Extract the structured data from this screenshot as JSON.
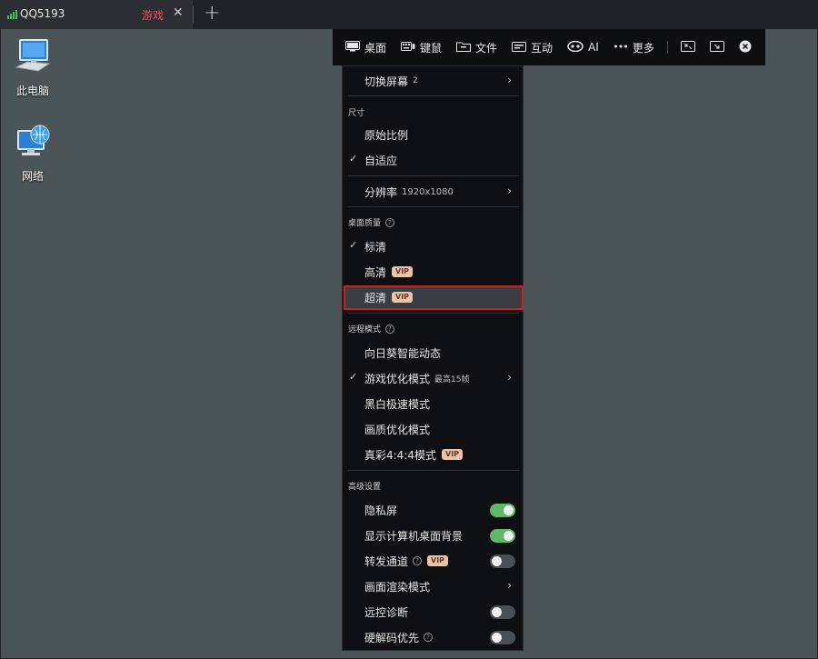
{
  "tab": {
    "title": "QQ5193",
    "game_label": "游戏",
    "close_glyph": "✕",
    "add_glyph": "+",
    "signal_color": "#39c15a",
    "game_color": "#ef4b5f"
  },
  "desktop": {
    "icons": [
      {
        "label": "此电脑",
        "icon": "computer-icon"
      },
      {
        "label": "网络",
        "icon": "network-icon"
      }
    ]
  },
  "toolbar": {
    "items": [
      {
        "label": "桌面",
        "icon": "desktop-icon"
      },
      {
        "label": "键鼠",
        "icon": "keyboard-mouse-icon"
      },
      {
        "label": "文件",
        "icon": "file-icon"
      },
      {
        "label": "互动",
        "icon": "interact-icon"
      },
      {
        "label": "AI",
        "icon": "ai-icon"
      },
      {
        "label": "更多",
        "icon": "more-icon"
      }
    ],
    "extra_icons": [
      "shrink-icon",
      "fit-window-icon",
      "close-icon"
    ]
  },
  "menu": {
    "switch_screen": {
      "label": "切换屏幕",
      "count": "2"
    },
    "size_header": "尺寸",
    "original_ratio": "原始比例",
    "auto_fit": "自适应",
    "resolution": {
      "label": "分辨率",
      "value": "1920x1080"
    },
    "quality_header": "桌面质量",
    "quality": {
      "sd": "标清",
      "hd": "高清",
      "uhd": "超清"
    },
    "vip": "VIP",
    "remote_header": "远程模式",
    "modes": {
      "smart": "向日葵智能动态",
      "game": "游戏优化模式",
      "game_fps": "最高15帧",
      "bw": "黑白极速模式",
      "quality": "画质优化模式",
      "truecolor": "真彩4:4:4模式"
    },
    "advanced_header": "高级设置",
    "advanced": {
      "privacy": "隐私屏",
      "show_bg": "显示计算机桌面背景",
      "relay": "转发通道",
      "render": "画面渲染模式",
      "diagnose": "远控诊断",
      "hw_decode": "硬解码优先"
    },
    "toggles": {
      "privacy": true,
      "show_bg": true,
      "relay": false,
      "diagnose": false,
      "hw_decode": false
    },
    "checked": [
      "自适应",
      "标清",
      "游戏优化模式"
    ],
    "toggle_on_color": "#5fb86a",
    "highlight_color": "#d11f1f"
  },
  "glyphs": {
    "check": "✓",
    "chevron": "›",
    "question": "?"
  }
}
